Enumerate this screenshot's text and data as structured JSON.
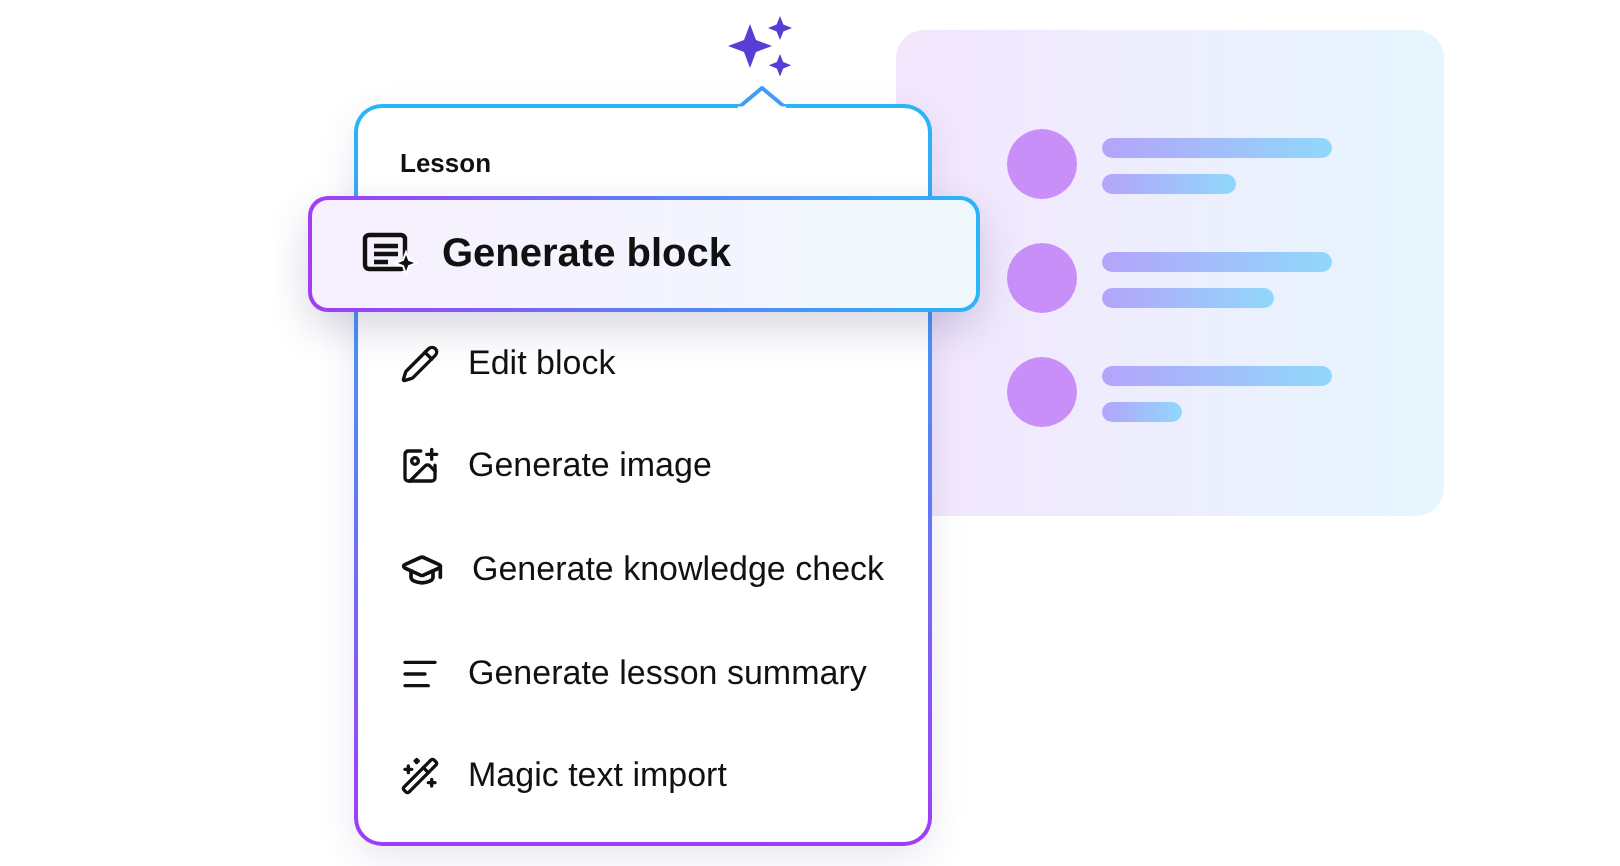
{
  "menu": {
    "heading": "Lesson",
    "items": [
      {
        "kind": "block",
        "label": "Generate block",
        "selected": true
      },
      {
        "kind": "edit",
        "label": "Edit block",
        "selected": false
      },
      {
        "kind": "image",
        "label": "Generate image",
        "selected": false
      },
      {
        "kind": "check",
        "label": "Generate knowledge check",
        "selected": false
      },
      {
        "kind": "summary",
        "label": "Generate lesson summary",
        "selected": false
      },
      {
        "kind": "import",
        "label": "Magic text import",
        "selected": false
      }
    ]
  }
}
